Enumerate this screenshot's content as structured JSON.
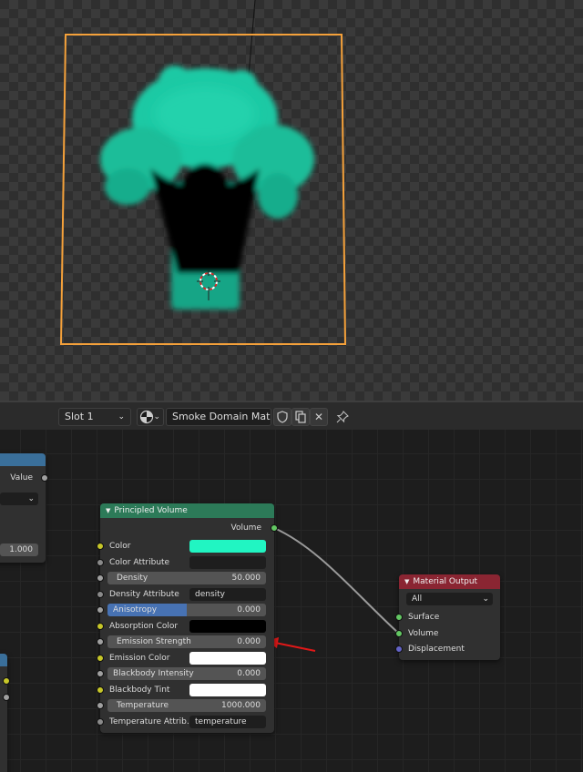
{
  "header": {
    "slot": "Slot 1",
    "material_name": "Smoke Domain Mat..."
  },
  "value_node": {
    "output_label": "Value",
    "value": "1.000"
  },
  "principled_volume": {
    "title": "Principled Volume",
    "output_label": "Volume",
    "color_label": "Color",
    "color_value": "#21f5c2",
    "color_attribute_label": "Color Attribute",
    "density_label": "Density",
    "density_value": "50.000",
    "density_attribute_label": "Density Attribute",
    "density_attribute_value": "density",
    "anisotropy_label": "Anisotropy",
    "anisotropy_value": "0.000",
    "absorption_color_label": "Absorption Color",
    "absorption_color_value": "#000000",
    "emission_strength_label": "Emission Strength",
    "emission_strength_value": "0.000",
    "emission_color_label": "Emission Color",
    "emission_color_value": "#ffffff",
    "blackbody_intensity_label": "Blackbody Intensity",
    "blackbody_intensity_value": "0.000",
    "blackbody_tint_label": "Blackbody Tint",
    "blackbody_tint_value": "#ffffff",
    "temperature_label": "Temperature",
    "temperature_value": "1000.000",
    "temperature_attribute_label": "Temperature Attrib...",
    "temperature_attribute_value": "temperature"
  },
  "material_output": {
    "title": "Material Output",
    "target": "All",
    "surface_label": "Surface",
    "volume_label": "Volume",
    "displacement_label": "Displacement"
  },
  "colors": {
    "selection_orange": "#f5a13a",
    "smoke_teal": "#1fc9a4",
    "shader_node_header": "#2c7a58",
    "output_node_header": "#8a2532",
    "annotation_arrow": "#e01818"
  },
  "icons": [
    "chevron-down-icon",
    "material-sphere-icon",
    "shield-icon",
    "copy-icon",
    "close-icon",
    "pin-icon",
    "3d-cursor-icon"
  ]
}
